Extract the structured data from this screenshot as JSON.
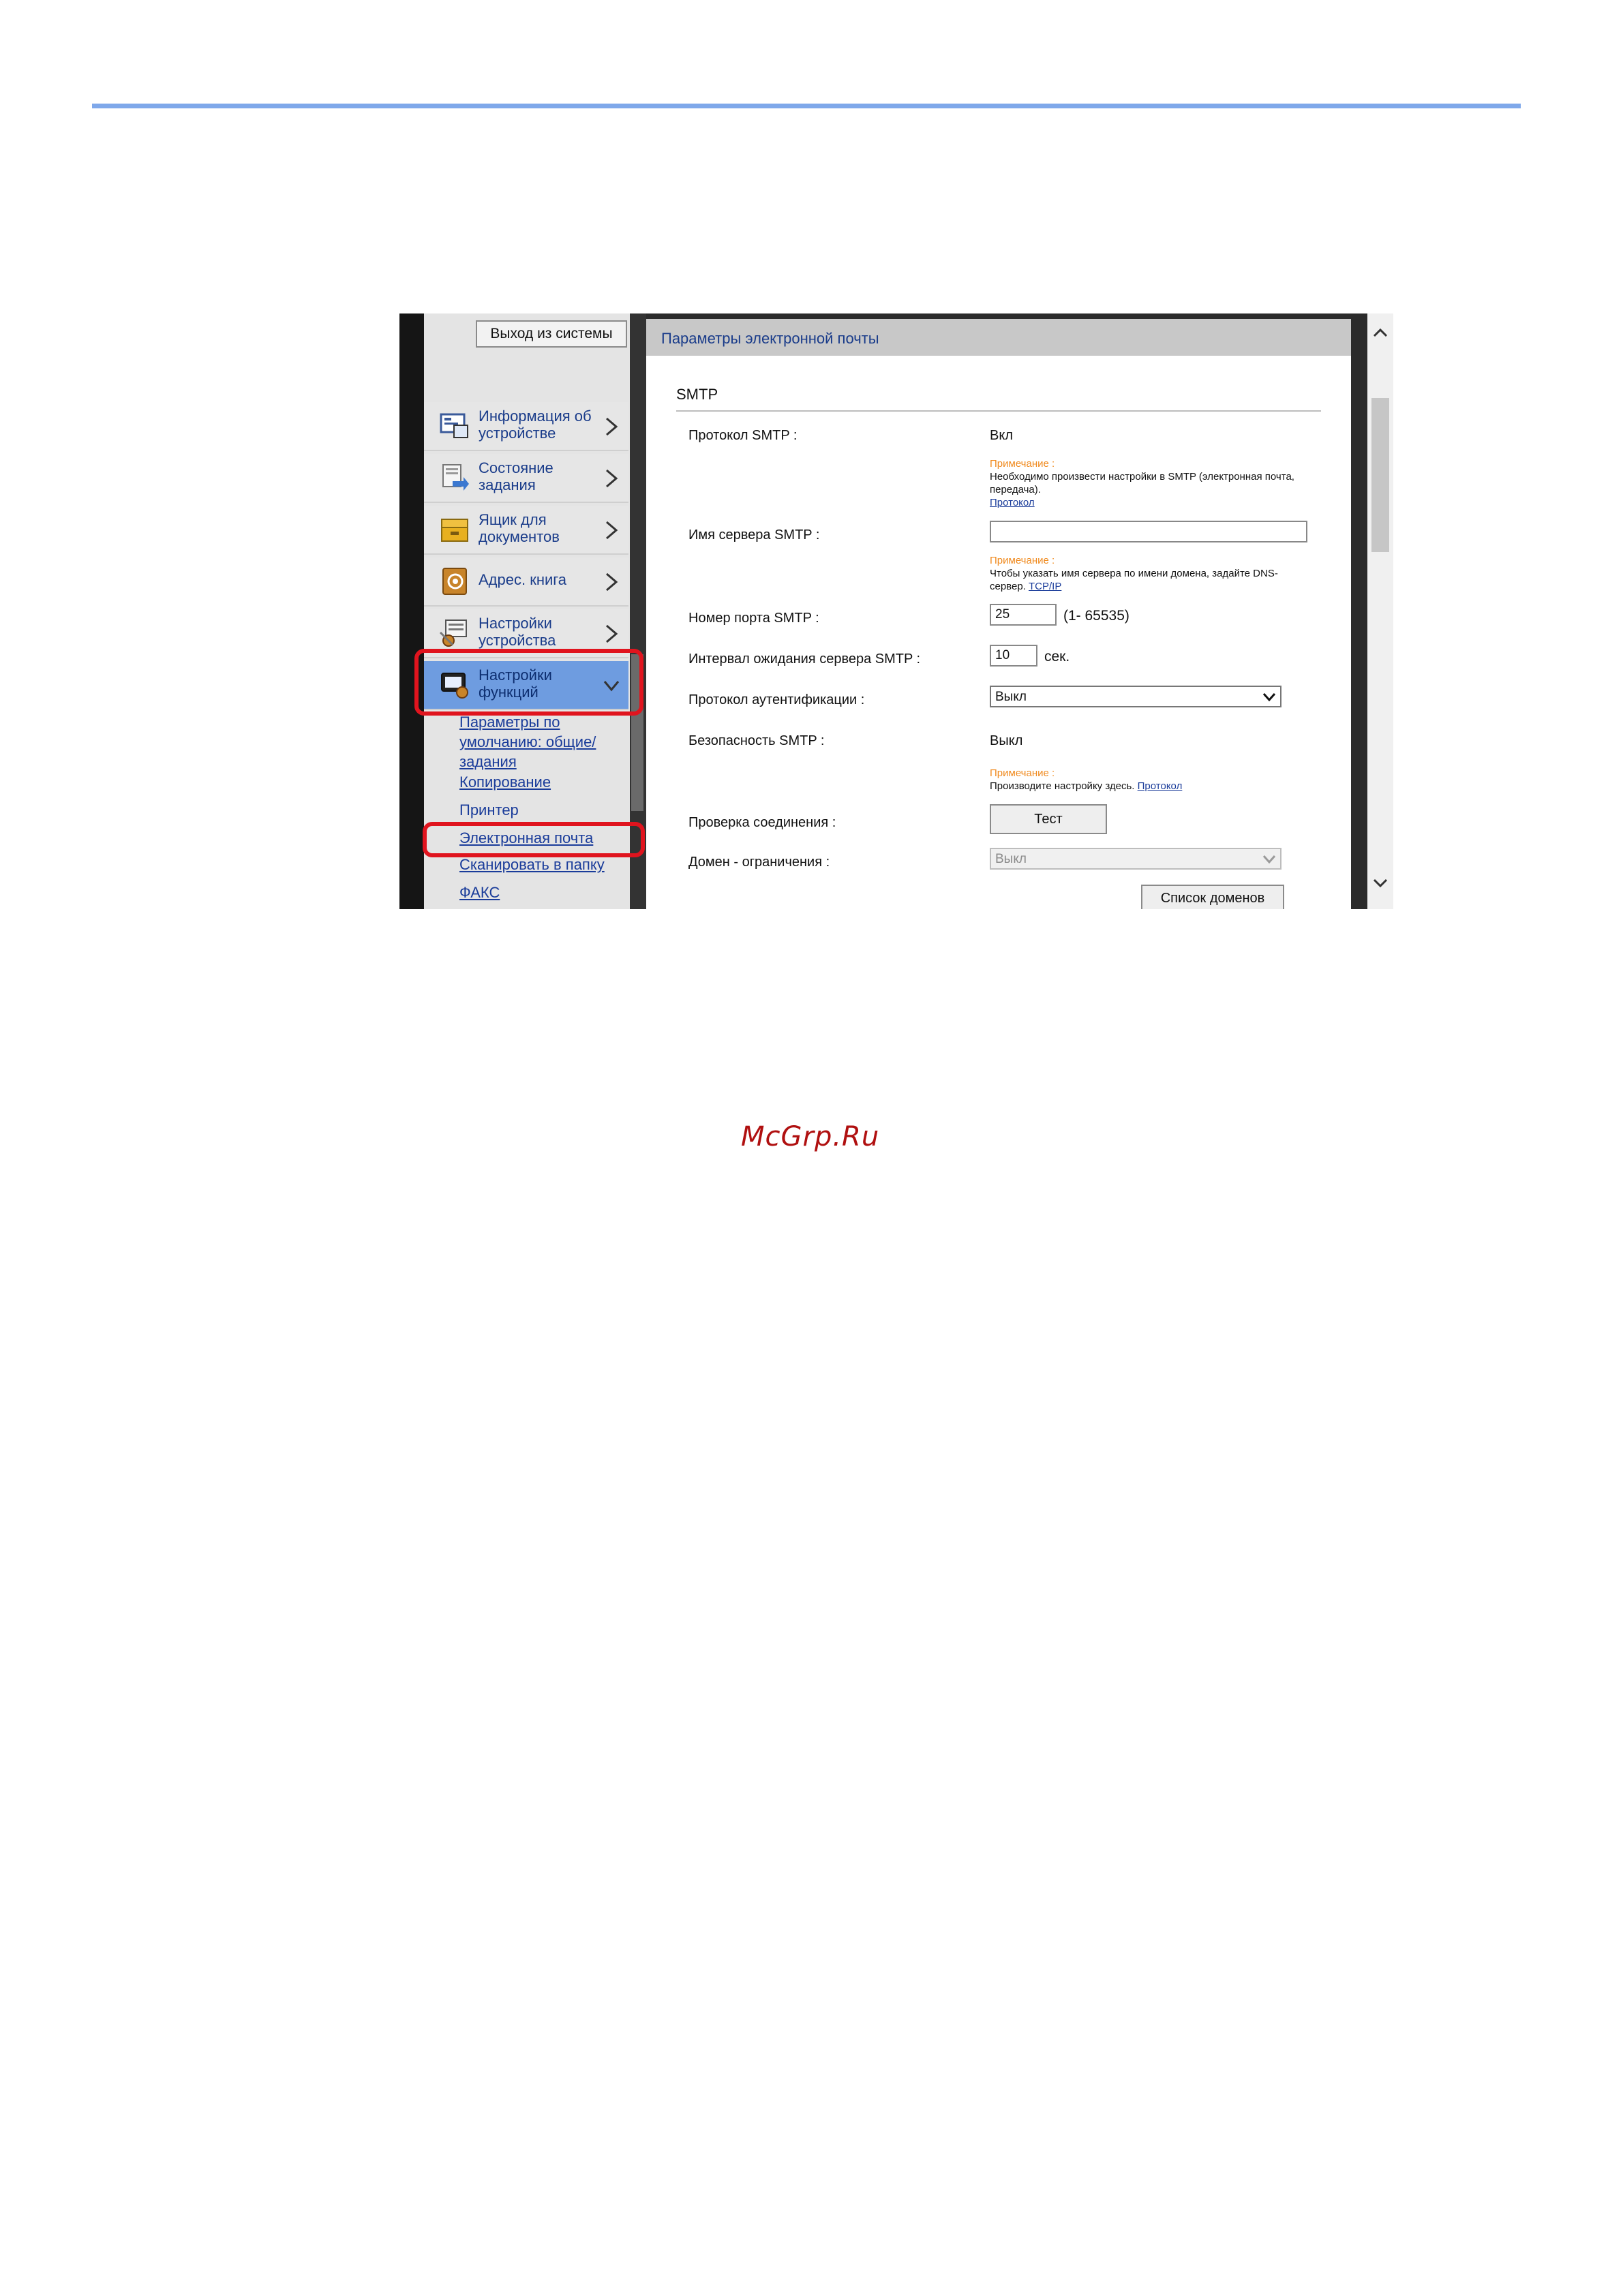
{
  "sidebar": {
    "logout_label": "Выход из системы",
    "items": [
      {
        "label": "Информация об устройстве",
        "icon": "device-info-icon"
      },
      {
        "label": "Состояние задания",
        "icon": "job-status-icon"
      },
      {
        "label": "Ящик для документов",
        "icon": "document-box-icon"
      },
      {
        "label": "Адрес. книга",
        "icon": "address-book-icon"
      },
      {
        "label": "Настройки устройства",
        "icon": "device-settings-icon"
      },
      {
        "label": "Настройки функций",
        "icon": "function-settings-icon",
        "active": true
      }
    ],
    "sub_items": [
      "Параметры по умолчанию: общие/задания",
      "Копирование",
      "Принтер",
      "Электронная почта",
      "Сканировать в папку",
      "ФАКС"
    ]
  },
  "main": {
    "header": "Параметры электронной почты",
    "section_title": "SMTP",
    "rows": {
      "smtp_protocol": {
        "label": "Протокол SMTP :",
        "value": "Вкл"
      },
      "note1": {
        "title": "Примечание :",
        "text": "Необходимо произвести настройки в SMTP (электронная почта, передача).",
        "link": "Протокол"
      },
      "smtp_server": {
        "label": "Имя сервера SMTP :",
        "value": ""
      },
      "note2": {
        "title": "Примечание :",
        "text": "Чтобы указать имя сервера по имени домена, задайте DNS-сервер.",
        "link": "TCP/IP"
      },
      "smtp_port": {
        "label": "Номер порта SMTP :",
        "value": "25",
        "range": "(1- 65535)"
      },
      "smtp_timeout": {
        "label": "Интервал ожидания сервера SMTP :",
        "value": "10",
        "unit": "сек."
      },
      "auth_protocol": {
        "label": "Протокол аутентификации :",
        "value": "Выкл"
      },
      "smtp_security": {
        "label": "Безопасность SMTP :",
        "value": "Выкл"
      },
      "note3": {
        "title": "Примечание :",
        "text": "Производите настройку здесь.",
        "link": "Протокол"
      },
      "connection_test": {
        "label": "Проверка соединения :",
        "button": "Тест"
      },
      "domain_restriction": {
        "label": "Домен - ограничения :",
        "value": "Выкл"
      },
      "domain_list_button": "Список доменов"
    }
  },
  "watermark": "McGrp.Ru",
  "colors": {
    "highlight": "#e0141e",
    "rule": "#7fa8ea",
    "active_nav": "#6e9ce0",
    "note": "#f08a1e"
  }
}
